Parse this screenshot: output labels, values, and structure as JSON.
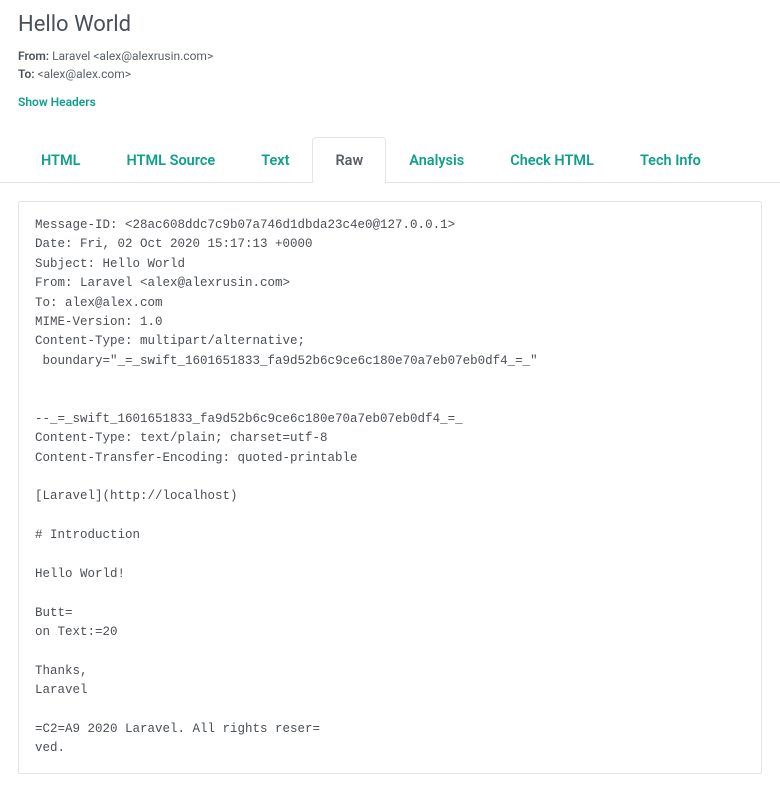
{
  "subject": "Hello World",
  "meta": {
    "from_label": "From:",
    "from_value": " Laravel <alex@alexrusin.com>",
    "to_label": "To:",
    "to_value": "  <alex@alex.com>"
  },
  "show_headers_label": "Show Headers",
  "tabs": {
    "html": "HTML",
    "html_source": "HTML Source",
    "text": "Text",
    "raw": "Raw",
    "analysis": "Analysis",
    "check_html": "Check HTML",
    "tech_info": "Tech Info"
  },
  "raw_content": "Message-ID: <28ac608ddc7c9b07a746d1dbda23c4e0@127.0.0.1>\nDate: Fri, 02 Oct 2020 15:17:13 +0000\nSubject: Hello World\nFrom: Laravel <alex@alexrusin.com>\nTo: alex@alex.com\nMIME-Version: 1.0\nContent-Type: multipart/alternative;\n boundary=\"_=_swift_1601651833_fa9d52b6c9ce6c180e70a7eb07eb0df4_=_\"\n\n\n--_=_swift_1601651833_fa9d52b6c9ce6c180e70a7eb07eb0df4_=_\nContent-Type: text/plain; charset=utf-8\nContent-Transfer-Encoding: quoted-printable\n\n[Laravel](http://localhost)\n\n# Introduction\n\nHello World!\n\nButt=\non Text:=20\n\nThanks,\nLaravel\n\n=C2=A9 2020 Laravel. All rights reser=\nved."
}
